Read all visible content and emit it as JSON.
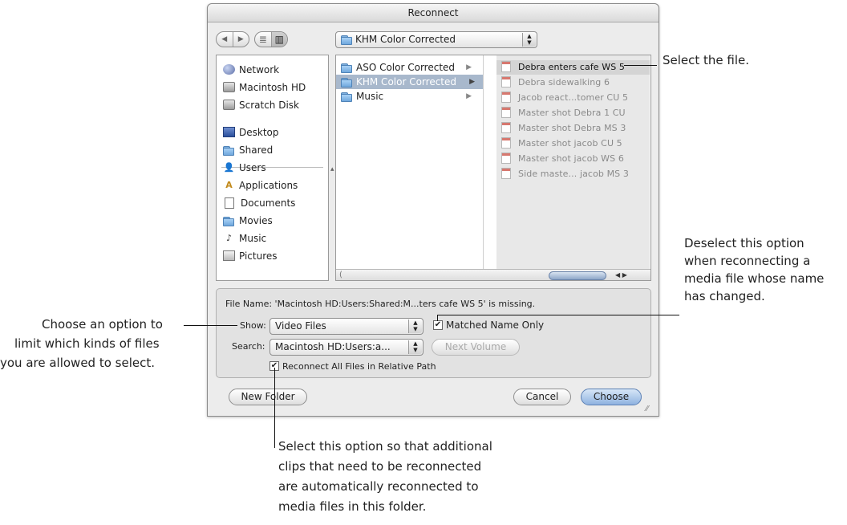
{
  "dialog": {
    "title": "Reconnect",
    "nav": {
      "back": "◀",
      "forward": "▶"
    },
    "view_modes": {
      "list": "≣",
      "column": "▥"
    },
    "location_popup": "KHM Color Corrected",
    "sidebar": {
      "items": [
        {
          "label": "Network",
          "icon": "network-icon"
        },
        {
          "label": "Macintosh HD",
          "icon": "hard-disk-icon"
        },
        {
          "label": "Scratch Disk",
          "icon": "hard-disk-icon"
        },
        {
          "label": "Desktop",
          "icon": "desktop-icon"
        },
        {
          "label": "Shared",
          "icon": "folder-icon"
        },
        {
          "label": "Users",
          "icon": "users-icon"
        },
        {
          "label": "Applications",
          "icon": "applications-icon"
        },
        {
          "label": "Documents",
          "icon": "documents-icon"
        },
        {
          "label": "Movies",
          "icon": "folder-icon"
        },
        {
          "label": "Music",
          "icon": "music-icon"
        },
        {
          "label": "Pictures",
          "icon": "pictures-icon"
        }
      ]
    },
    "browser": {
      "column1": [
        {
          "label": "ASO Color Corrected",
          "selected": false
        },
        {
          "label": "KHM Color Corrected",
          "selected": true
        },
        {
          "label": "Music",
          "selected": false
        }
      ],
      "column2": [
        {
          "label": "Debra enters cafe WS 5",
          "selected": true
        },
        {
          "label": "Debra sidewalking 6",
          "selected": false
        },
        {
          "label": "Jacob react...tomer CU 5",
          "selected": false
        },
        {
          "label": "Master shot Debra 1 CU",
          "selected": false
        },
        {
          "label": "Master shot Debra MS 3",
          "selected": false
        },
        {
          "label": "Master shot jacob CU 5",
          "selected": false
        },
        {
          "label": "Master shot jacob WS 6",
          "selected": false
        },
        {
          "label": "Side maste... jacob MS 3",
          "selected": false
        }
      ]
    },
    "options": {
      "file_name": "File Name: 'Macintosh HD:Users:Shared:M...ters cafe WS 5' is missing.",
      "show_label": "Show:",
      "show_value": "Video Files",
      "matched_name_only": "Matched Name Only",
      "matched_name_checked": true,
      "search_label": "Search:",
      "search_value": "Macintosh HD:Users:a...",
      "next_volume": "Next Volume",
      "reconnect_all": "Reconnect All Files in Relative Path",
      "reconnect_all_checked": true
    },
    "buttons": {
      "new_folder": "New Folder",
      "cancel": "Cancel",
      "choose": "Choose"
    }
  },
  "annotations": {
    "select_file": "Select the file.",
    "deselect": [
      "Deselect this option",
      "when reconnecting a",
      "media file whose name",
      "has changed."
    ],
    "choose_option": [
      "Choose an option to",
      "limit which kinds of files",
      "you are allowed to select."
    ],
    "select_option": [
      "Select this option so that additional",
      "clips that need to be reconnected",
      "are automatically reconnected to",
      "media files in this folder."
    ]
  }
}
